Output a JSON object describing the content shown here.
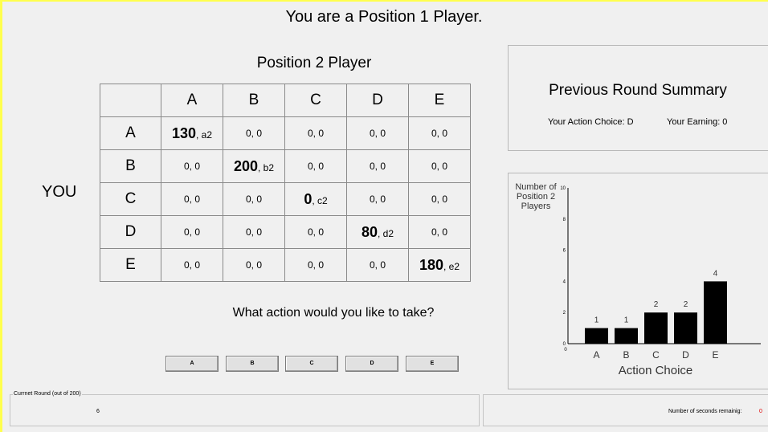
{
  "title": "You are a Position 1 Player.",
  "opponent_title": "Position 2 Player",
  "row_player_label": "YOU",
  "matrix": {
    "col_headers": [
      "A",
      "B",
      "C",
      "D",
      "E"
    ],
    "rows": [
      {
        "header": "A",
        "cells": [
          [
            "130",
            "a2"
          ],
          "0, 0",
          "0, 0",
          "0, 0",
          "0, 0"
        ]
      },
      {
        "header": "B",
        "cells": [
          "0, 0",
          [
            "200",
            "b2"
          ],
          "0, 0",
          "0, 0",
          "0, 0"
        ]
      },
      {
        "header": "C",
        "cells": [
          "0, 0",
          "0, 0",
          [
            "0",
            "c2"
          ],
          "0, 0",
          "0, 0"
        ]
      },
      {
        "header": "D",
        "cells": [
          "0, 0",
          "0, 0",
          "0, 0",
          [
            "80",
            "d2"
          ],
          "0, 0"
        ]
      },
      {
        "header": "E",
        "cells": [
          "0, 0",
          "0, 0",
          "0, 0",
          "0, 0",
          [
            "180",
            "e2"
          ]
        ]
      }
    ]
  },
  "question": "What action would you like to take?",
  "buttons": [
    "A",
    "B",
    "C",
    "D",
    "E"
  ],
  "summary": {
    "title": "Previous Round Summary",
    "action_choice": "Your Action Choice: D",
    "earning": "Your Earning: 0"
  },
  "chart_data": {
    "type": "bar",
    "categories": [
      "A",
      "B",
      "C",
      "D",
      "E"
    ],
    "values": [
      1,
      1,
      2,
      2,
      4
    ],
    "data_labels": [
      "1",
      "1",
      "2",
      "2",
      "4"
    ],
    "ylabel": "Number of Position 2 Players",
    "xlabel": "Action Choice",
    "ylim": [
      0,
      10
    ],
    "yticks": [
      0,
      2,
      4,
      6,
      8,
      10
    ],
    "xorigin_label": "0",
    "grid": false
  },
  "round": {
    "legend": "Currnet Round (out of 200)",
    "value": "6"
  },
  "timer": {
    "label": "Number of seconds remainig:",
    "value": "0",
    "value_color": "#e00000"
  }
}
